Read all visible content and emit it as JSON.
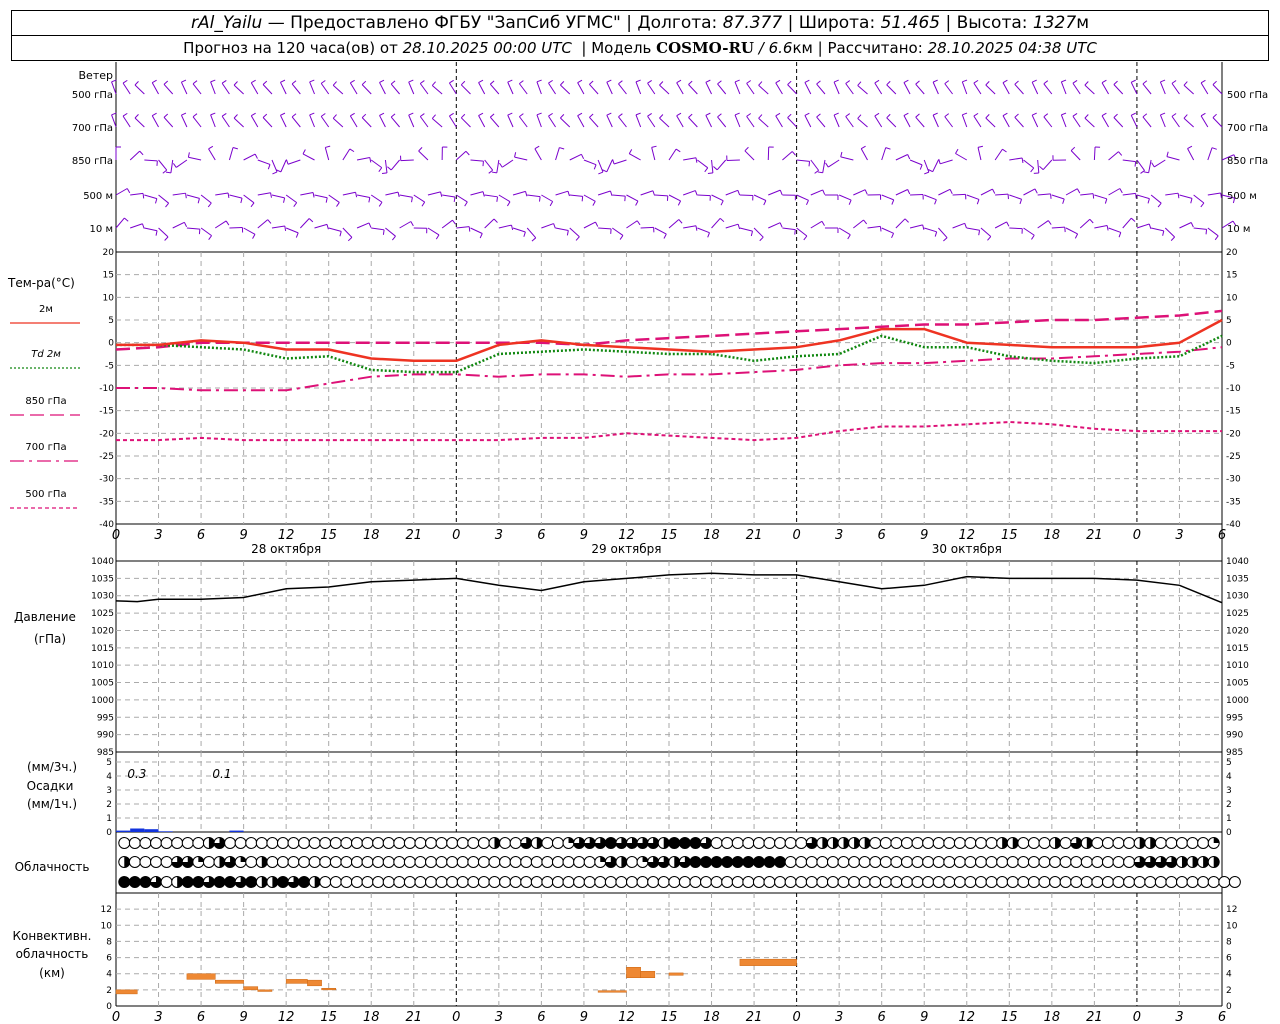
{
  "header": {
    "station": "rAl_Yailu",
    "provider": "— Предоставлено ФГБУ \"ЗапСиб УГМС\"",
    "lon_label": "Долгота:",
    "lon_value": "87.377",
    "lat_label": "Широта:",
    "lat_value": "51.465",
    "alt_label": "Высота:",
    "alt_value": "1327",
    "alt_unit": "м",
    "forecast_prefix": "Прогноз на 120 часа(ов) от",
    "forecast_start": "28.10.2025 00:00 UTC",
    "model_label": "Модель",
    "model_name": "COSMO-RU",
    "model_res": "/ 6.6",
    "model_res_unit": "км",
    "computed_label": "Рассчитано:",
    "computed_time": "28.10.2025 04:38 UTC"
  },
  "wind_panel": {
    "title": "Ветер",
    "levels": [
      "500 гПа",
      "700 гПа",
      "850 гПа",
      "500 м",
      "10  м"
    ],
    "barb_color": "#7a00cc"
  },
  "temp_panel": {
    "title": "Тем-ра(°С)",
    "legend": [
      {
        "label": "2м",
        "color": "#ee3322",
        "style": "solid"
      },
      {
        "label": "Td 2м",
        "color": "#118811",
        "style": "dotted"
      },
      {
        "label": "850 гПа",
        "color": "#dd1177",
        "style": "long-dash"
      },
      {
        "label": "700 гПа",
        "color": "#dd1177",
        "style": "dash-dot"
      },
      {
        "label": "500 гПа",
        "color": "#dd1177",
        "style": "short-dash"
      }
    ]
  },
  "pressure_panel": {
    "title": "Давление",
    "unit": "(гПа)"
  },
  "precip_panel": {
    "unit3": "(мм/3ч.)",
    "title": "Осадки",
    "unit1": "(мм/1ч.)",
    "annotations": [
      {
        "hour": 3,
        "text": "0.3"
      },
      {
        "hour": 9,
        "text": "0.1"
      }
    ]
  },
  "cloud_panel": {
    "title": "Облачность"
  },
  "conv_panel": {
    "title_1": "Конвективн.",
    "title_2": "облачность",
    "title_3": "(км)"
  },
  "x_axis": {
    "hour_labels": [
      "0",
      "3",
      "6",
      "9",
      "12",
      "15",
      "18",
      "21",
      "0",
      "3",
      "6",
      "9",
      "12",
      "15",
      "18",
      "21",
      "0",
      "3",
      "6",
      "9",
      "12",
      "15",
      "18",
      "21",
      "0",
      "3",
      "6"
    ],
    "day_labels": [
      "28 октября",
      "29 октября",
      "30 октября"
    ]
  },
  "chart_data": [
    {
      "type": "line",
      "title": "Тем-ра(°С)",
      "x_unit": "hours from 28.10.2025 00:00 UTC",
      "ylim": [
        -40,
        20
      ],
      "y_ticks": [
        20,
        15,
        10,
        5,
        0,
        -5,
        -10,
        -15,
        -20,
        -25,
        -30,
        -35,
        -40
      ],
      "series": [
        {
          "name": "2м",
          "x": [
            0,
            3,
            6,
            9,
            12,
            15,
            18,
            21,
            24,
            27,
            30,
            33,
            36,
            39,
            42,
            45,
            48,
            51,
            54,
            57,
            60,
            63,
            66,
            69,
            72,
            75,
            78
          ],
          "values": [
            -0.5,
            -0.5,
            0.5,
            0,
            -1.5,
            -1.5,
            -3.5,
            -4,
            -4,
            -0.5,
            0.5,
            -0.5,
            -1,
            -1.5,
            -2,
            -1.5,
            -1,
            0.5,
            3,
            3,
            0,
            -0.5,
            -1,
            -1,
            -1,
            0,
            5
          ]
        },
        {
          "name": "Td 2м",
          "x": [
            0,
            3,
            6,
            9,
            12,
            15,
            18,
            21,
            24,
            27,
            30,
            33,
            36,
            39,
            42,
            45,
            48,
            51,
            54,
            57,
            60,
            63,
            66,
            69,
            72,
            75,
            78
          ],
          "values": [
            -0.5,
            -0.5,
            -1,
            -1.5,
            -3.5,
            -3,
            -6,
            -6.5,
            -6.5,
            -2.5,
            -2,
            -1.5,
            -2,
            -2.5,
            -2.5,
            -4,
            -3,
            -2.5,
            1.5,
            -1,
            -1,
            -3,
            -4,
            -4.5,
            -3.5,
            -3,
            1.5
          ]
        },
        {
          "name": "850 гПа",
          "x": [
            0,
            3,
            6,
            9,
            12,
            15,
            18,
            21,
            24,
            27,
            30,
            33,
            36,
            39,
            42,
            45,
            48,
            51,
            54,
            57,
            60,
            63,
            66,
            69,
            72,
            75,
            78
          ],
          "values": [
            -1.5,
            -1,
            0,
            0,
            0,
            0,
            0,
            0,
            0,
            0,
            0,
            -0.5,
            0.5,
            1,
            1.5,
            2,
            2.5,
            3,
            3.5,
            4,
            4,
            4.5,
            5,
            5,
            5.5,
            6,
            7
          ]
        },
        {
          "name": "700 гПа",
          "x": [
            0,
            3,
            6,
            9,
            12,
            15,
            18,
            21,
            24,
            27,
            30,
            33,
            36,
            39,
            42,
            45,
            48,
            51,
            54,
            57,
            60,
            63,
            66,
            69,
            72,
            75,
            78
          ],
          "values": [
            -10,
            -10,
            -10.5,
            -10.5,
            -10.5,
            -9,
            -7.5,
            -7,
            -7,
            -7.5,
            -7,
            -7,
            -7.5,
            -7,
            -7,
            -6.5,
            -6,
            -5,
            -4.5,
            -4.5,
            -4,
            -3.5,
            -3.5,
            -3,
            -2.5,
            -2,
            -1
          ]
        },
        {
          "name": "500 гПа",
          "x": [
            0,
            3,
            6,
            9,
            12,
            15,
            18,
            21,
            24,
            27,
            30,
            33,
            36,
            39,
            42,
            45,
            48,
            51,
            54,
            57,
            60,
            63,
            66,
            69,
            72,
            75,
            78
          ],
          "values": [
            -21.5,
            -21.5,
            -21,
            -21.5,
            -21.5,
            -21.5,
            -21.5,
            -21.5,
            -21.5,
            -21.5,
            -21,
            -21,
            -20,
            -20.5,
            -21,
            -21.5,
            -21,
            -19.5,
            -18.5,
            -18.5,
            -18,
            -17.5,
            -18,
            -19,
            -19.5,
            -19.5,
            -19.5
          ]
        }
      ]
    },
    {
      "type": "line",
      "title": "Давление",
      "ylabel": "(гПа)",
      "ylim": [
        985,
        1040
      ],
      "y_ticks": [
        1040,
        1035,
        1030,
        1025,
        1020,
        1015,
        1010,
        1005,
        1000,
        995,
        990,
        985
      ],
      "series": [
        {
          "x": [
            0,
            1.5,
            3,
            6,
            9,
            12,
            15,
            18,
            21,
            24,
            27,
            30,
            33,
            36,
            39,
            42,
            45,
            48,
            51,
            54,
            57,
            60,
            63,
            66,
            69,
            72,
            75,
            78
          ],
          "values": [
            1028.5,
            1028.3,
            1029,
            1029,
            1029.5,
            1032,
            1032.5,
            1034,
            1034.5,
            1035,
            1033,
            1031.5,
            1034,
            1035,
            1036,
            1036.5,
            1036,
            1036,
            1034,
            1032,
            1033,
            1035.5,
            1035,
            1035,
            1035,
            1034.5,
            1033,
            1028
          ]
        }
      ]
    },
    {
      "type": "bar",
      "title": "Осадки",
      "ylabel": "(мм/1ч.)",
      "ylim": [
        0,
        5
      ],
      "y_ticks": [
        5,
        4,
        3,
        2,
        1,
        0
      ],
      "x": [
        0.5,
        1.5,
        2.5,
        3.5,
        8.5
      ],
      "values": [
        0.1,
        0.25,
        0.2,
        0.05,
        0.1
      ]
    },
    {
      "type": "table",
      "title": "Облачность",
      "rows_note": "cloud cover fraction per 1-hour column (0, .25, .5, .75, 1)",
      "high": [
        0,
        0,
        0,
        0,
        0,
        0,
        0,
        0,
        0.5,
        0.75,
        0,
        0,
        0,
        0,
        0,
        0,
        0,
        0,
        0,
        0,
        0,
        0,
        0,
        0,
        0,
        0,
        0,
        0,
        0,
        0,
        0,
        0,
        0,
        0,
        0,
        0.5,
        0,
        0,
        0.75,
        0.5,
        0,
        0,
        0.25,
        0.75,
        0.75,
        0.75,
        1,
        0.75,
        0.75,
        0.75,
        0.75,
        0.5,
        1,
        1,
        1,
        0.75,
        0,
        0,
        0,
        0,
        0,
        0,
        0,
        0,
        0,
        0.75,
        0.5,
        0.5,
        0.5,
        0.5,
        0.5,
        0,
        0,
        0,
        0,
        0,
        0,
        0,
        0,
        0,
        0,
        0,
        0,
        0.5,
        0.5,
        0,
        0,
        0,
        0.5,
        0,
        0.75,
        0.5,
        0,
        0,
        0,
        0,
        0.5,
        0.5,
        0,
        0,
        0,
        0,
        0,
        0.25
      ],
      "mid": [
        0.5,
        0,
        0,
        0,
        0,
        0.75,
        0.75,
        0.25,
        0,
        0.5,
        0.75,
        0.25,
        0,
        0.5,
        0,
        0,
        0,
        0,
        0,
        0,
        0,
        0,
        0,
        0,
        0,
        0,
        0,
        0,
        0,
        0,
        0,
        0,
        0,
        0,
        0,
        0,
        0,
        0,
        0,
        0,
        0,
        0,
        0,
        0,
        0,
        0.25,
        0.75,
        0.5,
        0,
        0.25,
        0.75,
        0.75,
        0.5,
        0.75,
        1,
        1,
        1,
        1,
        1,
        1,
        1,
        1,
        1,
        0,
        0,
        0,
        0,
        0,
        0,
        0,
        0,
        0,
        0,
        0,
        0,
        0,
        0,
        0,
        0,
        0,
        0,
        0,
        0,
        0,
        0,
        0,
        0,
        0,
        0,
        0,
        0,
        0,
        0,
        0,
        0,
        0,
        0.75,
        0.75,
        0.75,
        0.75,
        0.5,
        0.5,
        0.5,
        0.5
      ],
      "low": [
        1,
        1,
        1,
        0.75,
        0,
        0.5,
        1,
        1,
        0.75,
        1,
        1,
        0.75,
        1,
        0.5,
        0.5,
        1,
        0.75,
        1,
        0.5,
        0,
        0,
        0,
        0,
        0,
        0,
        0,
        0,
        0,
        0,
        0,
        0,
        0,
        0,
        0,
        0,
        0,
        0,
        0,
        0,
        0,
        0,
        0,
        0,
        0,
        0,
        0,
        0,
        0,
        0,
        0,
        0,
        0,
        0,
        0,
        0,
        0,
        0,
        0,
        0,
        0,
        0,
        0,
        0,
        0,
        0,
        0,
        0,
        0,
        0,
        0,
        0,
        0,
        0,
        0,
        0,
        0,
        0,
        0,
        0,
        0,
        0,
        0,
        0,
        0,
        0,
        0,
        0,
        0,
        0,
        0,
        0,
        0,
        0,
        0,
        0,
        0,
        0,
        0,
        0,
        0,
        0,
        0,
        0,
        0,
        0,
        0
      ]
    },
    {
      "type": "bar",
      "title": "Конвективн. облачность",
      "ylabel": "(км)",
      "ylim": [
        0,
        14
      ],
      "y_ticks": [
        12,
        10,
        8,
        6,
        4,
        2,
        0
      ],
      "bars": [
        {
          "x0": 0,
          "x1": 1.5,
          "bottom": 1.5,
          "top": 2
        },
        {
          "x0": 5,
          "x1": 7,
          "bottom": 3.3,
          "top": 4
        },
        {
          "x0": 7,
          "x1": 9,
          "bottom": 2.8,
          "top": 3.2
        },
        {
          "x0": 9,
          "x1": 10,
          "bottom": 2,
          "top": 2.4
        },
        {
          "x0": 10,
          "x1": 11,
          "bottom": 1.8,
          "top": 2
        },
        {
          "x0": 12,
          "x1": 13.5,
          "bottom": 2.8,
          "top": 3.3
        },
        {
          "x0": 13.5,
          "x1": 14.5,
          "bottom": 2.5,
          "top": 3.2
        },
        {
          "x0": 14.5,
          "x1": 15.5,
          "bottom": 2,
          "top": 2.2
        },
        {
          "x0": 34,
          "x1": 36,
          "bottom": 1.7,
          "top": 1.9
        },
        {
          "x0": 36,
          "x1": 37,
          "bottom": 3.5,
          "top": 4.8
        },
        {
          "x0": 37,
          "x1": 38,
          "bottom": 3.5,
          "top": 4.3
        },
        {
          "x0": 39,
          "x1": 40,
          "bottom": 3.8,
          "top": 4.1
        },
        {
          "x0": 44,
          "x1": 48,
          "bottom": 5,
          "top": 5.8
        }
      ]
    }
  ]
}
